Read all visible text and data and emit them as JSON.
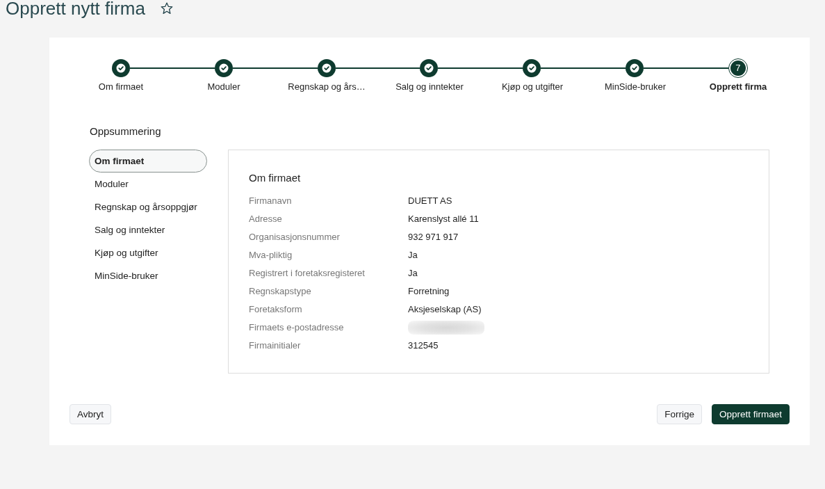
{
  "page": {
    "title": "Opprett nytt firma",
    "favorite": false
  },
  "steps": [
    {
      "label": "Om firmaet",
      "done": true,
      "selected": false
    },
    {
      "label": "Moduler",
      "done": true,
      "selected": false
    },
    {
      "label": "Regnskap og års…",
      "done": true,
      "selected": false
    },
    {
      "label": "Salg og inntekter",
      "done": true,
      "selected": false
    },
    {
      "label": "Kjøp og utgifter",
      "done": true,
      "selected": false
    },
    {
      "label": "MinSide-bruker",
      "done": true,
      "selected": false
    },
    {
      "label": "Opprett firma",
      "done": false,
      "selected": true,
      "number": "7"
    }
  ],
  "summary": {
    "title": "Oppsummering",
    "sections": [
      {
        "label": "Om firmaet",
        "selected": true
      },
      {
        "label": "Moduler",
        "selected": false
      },
      {
        "label": "Regnskap og årsoppgjør",
        "selected": false
      },
      {
        "label": "Salg og inntekter",
        "selected": false
      },
      {
        "label": "Kjøp og utgifter",
        "selected": false
      },
      {
        "label": "MinSide-bruker",
        "selected": false
      }
    ],
    "panel": {
      "heading": "Om firmaet",
      "rows": [
        {
          "label": "Firmanavn",
          "value": "DUETT AS",
          "redacted": false
        },
        {
          "label": "Adresse",
          "value": "Karenslyst allé 11",
          "redacted": false
        },
        {
          "label": "Organisasjonsnummer",
          "value": "932 971 917",
          "redacted": false
        },
        {
          "label": "Mva-pliktig",
          "value": "Ja",
          "redacted": false
        },
        {
          "label": "Registrert i foretaksregisteret",
          "value": "Ja",
          "redacted": false
        },
        {
          "label": "Regnskapstype",
          "value": "Forretning",
          "redacted": false
        },
        {
          "label": "Foretaksform",
          "value": "Aksjeselskap (AS)",
          "redacted": false
        },
        {
          "label": "Firmaets e-postadresse",
          "redacted": true
        },
        {
          "label": "Firmainitialer",
          "value": "312545",
          "redacted": false
        }
      ]
    }
  },
  "footer": {
    "left_buttons": [
      {
        "label": "Avbryt",
        "kind": "secondary"
      }
    ],
    "right_buttons": [
      {
        "label": "Forrige",
        "kind": "secondary"
      },
      {
        "label": "Opprett firmaet",
        "kind": "primary"
      }
    ]
  }
}
